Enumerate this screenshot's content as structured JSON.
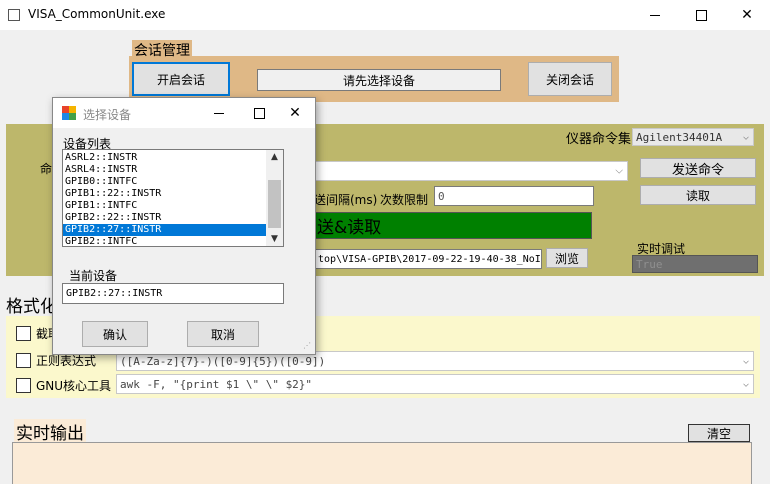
{
  "app": {
    "title": "VISA_CommonUnit.exe",
    "minimize_icon": "minimize-icon",
    "maximize_icon": "maximize-icon",
    "close_icon": "close-icon"
  },
  "session": {
    "group_label": "会话管理",
    "open_label": "开启会话",
    "status_text": "请先选择设备",
    "close_label": "关闭会话"
  },
  "command": {
    "cmd_label": "命",
    "instrument_set_label": "仪器命令集",
    "instrument_set_value": "Agilent34401A",
    "send_label": "发送命令",
    "read_label": "读取",
    "interval_label": "送间隔(ms)",
    "limit_label": "次数限制",
    "limit_value": "0",
    "send_read_label": "送&读取",
    "path_value": "top\\VISA-GPIB\\2017-09-22-19-40-38_NoIn",
    "browse_label": "浏览",
    "realtime_debug_label": "实时调试",
    "realtime_debug_value": "True"
  },
  "format": {
    "group_label": "格式化",
    "rows": [
      {
        "label": "截取",
        "value": ""
      },
      {
        "label": "正则表达式",
        "value": "([A-Za-z]{7}-)([0-9]{5})([0-9])"
      },
      {
        "label": "GNU核心工具",
        "value": "awk -F, \"{print $1 \\\"  \\\" $2}\""
      }
    ]
  },
  "output": {
    "title": "实时输出",
    "clear_label": "清空"
  },
  "dialog": {
    "title": "选择设备",
    "list_label": "设备列表",
    "devices": [
      "ASRL2::INSTR",
      "ASRL4::INSTR",
      "GPIB0::INTFC",
      "GPIB1::22::INSTR",
      "GPIB1::INTFC",
      "GPIB2::22::INSTR",
      "GPIB2::27::INSTR",
      "GPIB2::INTFC"
    ],
    "selected_device": "GPIB2::27::INSTR",
    "current_label": "当前设备",
    "current_value": "GPIB2::27::INSTR",
    "ok_label": "确认",
    "cancel_label": "取消"
  },
  "colors": {
    "session_bg": "#dfb886",
    "command_bg": "#bdb76b",
    "format_bg": "#fbf8cc",
    "output_bg": "#fbebd7",
    "selected": "#0078d7",
    "green_status": "#008000"
  }
}
